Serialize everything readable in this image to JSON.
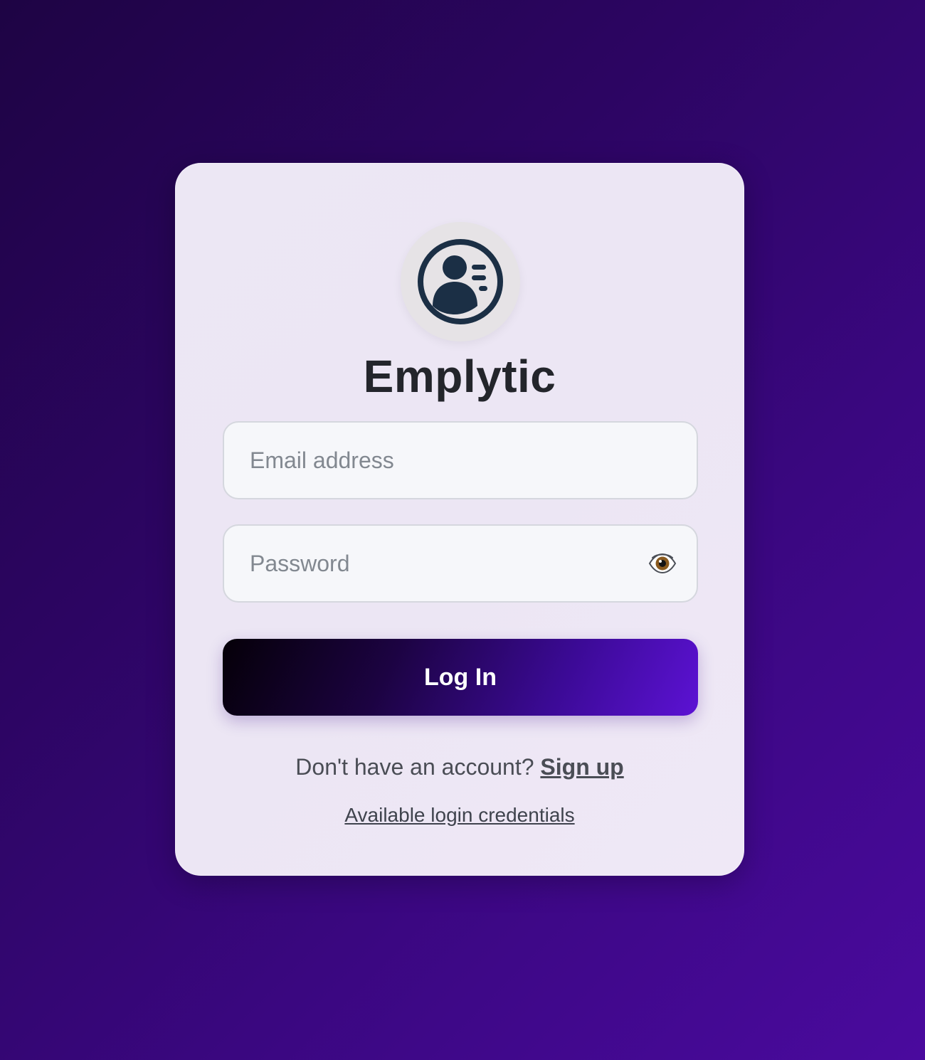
{
  "app": {
    "title": "Emplytic",
    "logo_icon": "user-profile-card-icon"
  },
  "form": {
    "email": {
      "value": "",
      "placeholder": "Email address"
    },
    "password": {
      "value": "",
      "placeholder": "Password",
      "toggle_icon": "eye-icon"
    },
    "submit_label": "Log In"
  },
  "footer": {
    "signup_prompt": "Don't have an account?",
    "signup_link": "Sign up",
    "credentials_link": "Available login credentials"
  },
  "colors": {
    "background_start": "#1e0444",
    "background_end": "#4a0a9e",
    "button_start": "#050008",
    "button_end": "#5c12d4",
    "icon_color": "#1b2f45"
  }
}
